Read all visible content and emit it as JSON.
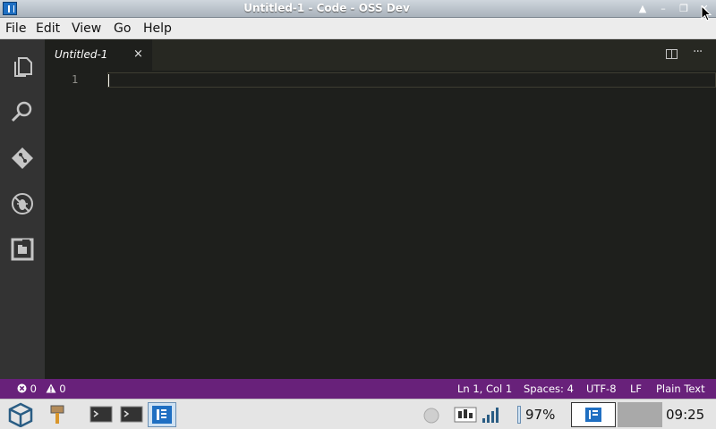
{
  "window": {
    "title": "Untitled-1 - Code - OSS Dev"
  },
  "menu": [
    "File",
    "Edit",
    "View",
    "Go",
    "Help"
  ],
  "activity_bar": [
    "explorer-icon",
    "search-icon",
    "source-control-icon",
    "debug-icon",
    "extensions-icon"
  ],
  "editor": {
    "tab_label": "Untitled-1",
    "tab_close": "×",
    "line_number": "1",
    "more_actions": "···"
  },
  "status": {
    "errors": "0",
    "warnings": "0",
    "position": "Ln 1, Col 1",
    "indent": "Spaces: 4",
    "encoding": "UTF-8",
    "eol": "LF",
    "language": "Plain Text"
  },
  "taskbar": {
    "battery": "97%",
    "clock": "09:25"
  },
  "colors": {
    "status_bar": "#68217a",
    "activity_bar": "#333333",
    "editor_bg": "#1e1f1c",
    "tab_bar": "#272822"
  }
}
